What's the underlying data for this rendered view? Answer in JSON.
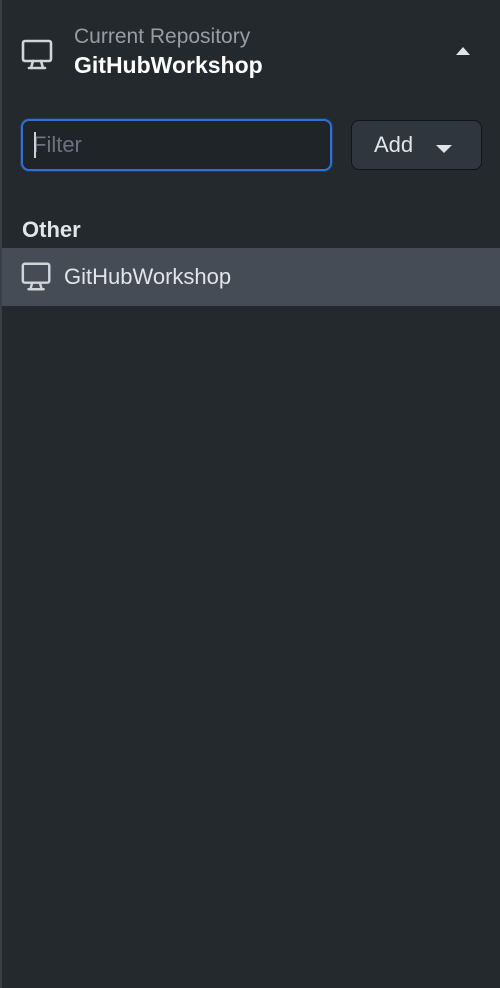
{
  "header": {
    "label": "Current Repository",
    "repo_name": "GitHubWorkshop",
    "repo_icon": "desktop-computer-icon",
    "toggle_icon": "triangle-up-icon"
  },
  "filter": {
    "placeholder": "Filter",
    "value": ""
  },
  "add_button": {
    "label": "Add",
    "icon": "triangle-down-icon"
  },
  "sections": [
    {
      "title": "Other",
      "items": [
        {
          "label": "GitHubWorkshop",
          "icon": "desktop-computer-icon",
          "selected": true
        }
      ]
    }
  ],
  "colors": {
    "background": "#24292e",
    "selected_row": "#454c56",
    "focus_ring": "#2f6fd6",
    "button_bg": "#2f363d"
  }
}
